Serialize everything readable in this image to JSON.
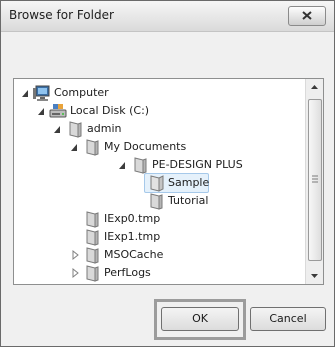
{
  "window": {
    "title": "Browse for Folder"
  },
  "tree": {
    "items": [
      {
        "label": "Computer",
        "expanded": true,
        "icon": "computer-icon"
      },
      {
        "label": "Local Disk (C:)",
        "expanded": true,
        "icon": "drive-icon"
      },
      {
        "label": "admin",
        "expanded": true,
        "icon": "folder-icon"
      },
      {
        "label": "My Documents",
        "expanded": true,
        "icon": "folder-icon"
      },
      {
        "label": "PE-DESIGN PLUS",
        "expanded": true,
        "icon": "folder-icon"
      },
      {
        "label": "Sample",
        "selected": true,
        "icon": "folder-open-icon"
      },
      {
        "label": "Tutorial",
        "icon": "folder-icon"
      },
      {
        "label": "IExp0.tmp",
        "icon": "folder-icon"
      },
      {
        "label": "IExp1.tmp",
        "icon": "folder-icon"
      },
      {
        "label": "MSOCache",
        "expandable": true,
        "icon": "folder-icon"
      },
      {
        "label": "PerfLogs",
        "expandable": true,
        "icon": "folder-icon"
      }
    ]
  },
  "buttons": {
    "ok": "OK",
    "cancel": "Cancel"
  },
  "colors": {
    "selection": "#e5f1fb",
    "selection_border": "#a6c9ea",
    "highlight_box": "#9c9c9c"
  }
}
